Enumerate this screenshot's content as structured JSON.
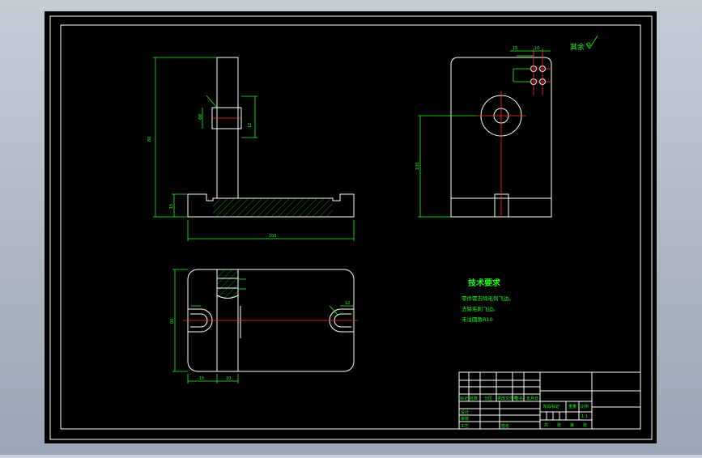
{
  "colors": {
    "background": "#000000",
    "outline": "#ffffff",
    "dimension": "#19ff19",
    "centerline": "#ff3030",
    "hatch": "#19ff19",
    "viewport": "#b8c0ca"
  },
  "roughness_note": {
    "text": "其余",
    "icon": "roughness-check-icon"
  },
  "tech_requirements": {
    "title": "技术要求",
    "items": [
      "零件需去除毛刺飞边。",
      "去除毛刺飞边。",
      "未注圆角R10"
    ]
  },
  "dimensions": {
    "front_height": "80",
    "front_width": "105",
    "front_base": "15",
    "right_height": "100",
    "top_depth": "60",
    "top_small_a": "15",
    "top_small_b": "10",
    "hole_dia": "Φ8",
    "hole_depth": "12",
    "slot_width": "12"
  },
  "title_block": {
    "row_labels": [
      "标记",
      "处数",
      "分区",
      "更改文件号",
      "签名",
      "年月日"
    ],
    "left_bottom": [
      "设计",
      "审核",
      "工艺"
    ],
    "middle": [
      "阶段标记",
      "重量",
      "比例"
    ],
    "scale": "1:1",
    "sheet": [
      "共",
      "张",
      "第",
      "张"
    ]
  }
}
